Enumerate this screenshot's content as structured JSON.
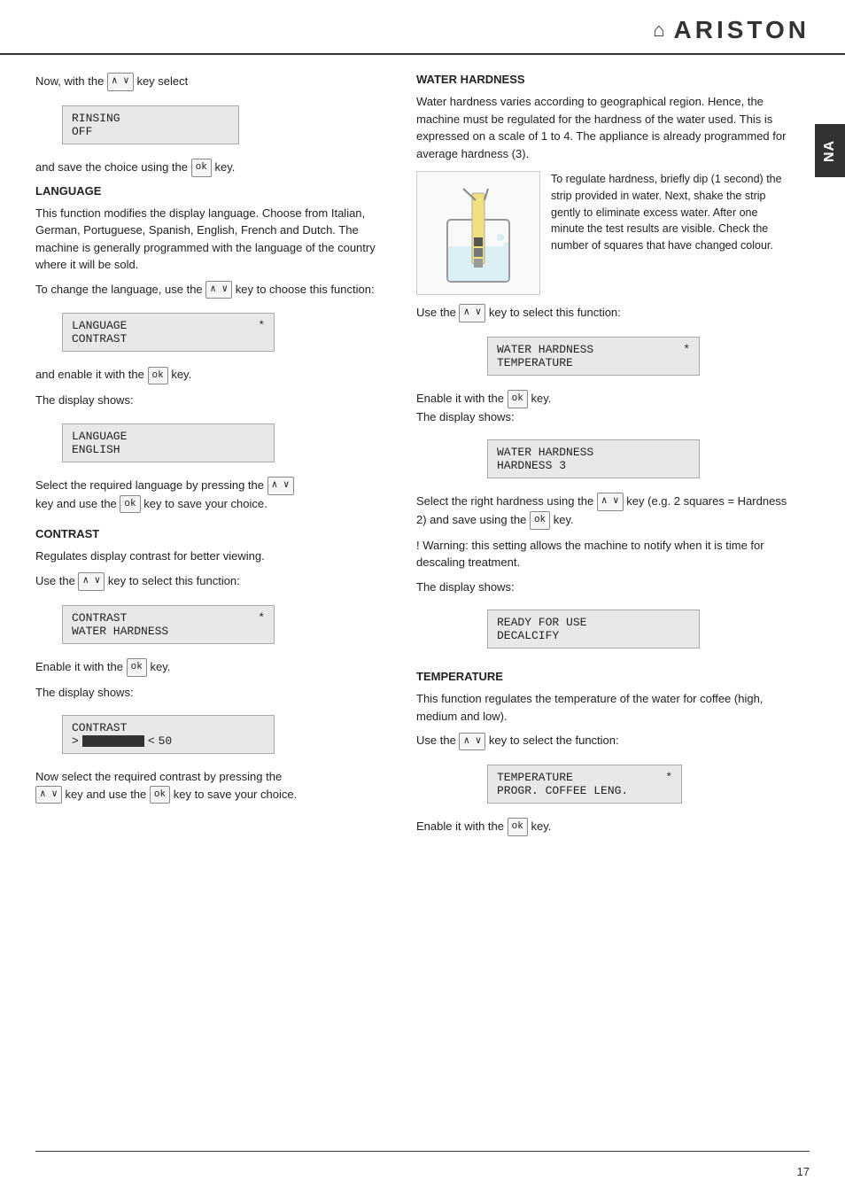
{
  "header": {
    "logo_icon": "🏠",
    "logo_name": "ARISTON"
  },
  "page_tab": "NA",
  "page_number": "17",
  "left_col": {
    "intro_text": "Now, with the",
    "intro_key": "∧  ∨",
    "intro_suffix": "key select",
    "lcd_rinsing": {
      "line1": "RINSING",
      "line2": "OFF"
    },
    "save_text_pre": "and save the choice using the",
    "save_key": "ok",
    "save_text_post": "key.",
    "language_title": "LANGUAGE",
    "language_p1": "This function modifies the display language. Choose from Italian, German, Portuguese, Spanish, English, French and Dutch. The machine is generally programmed with the language of the country where it will be sold.",
    "language_change_pre": "To change the language, use the",
    "language_change_key": "∧  ∨",
    "language_change_post": "key to choose this function:",
    "lcd_lang_select": {
      "line1": "LANGUAGE",
      "line1_star": "*",
      "line2": "CONTRAST"
    },
    "lang_enable_pre": "and enable it with the",
    "lang_enable_key": "ok",
    "lang_enable_post": "key.",
    "display_shows": "The display shows:",
    "lcd_lang_display": {
      "line1": "LANGUAGE",
      "line2": "ENGLISH"
    },
    "lang_select_pre": "Select the required language by pressing the",
    "lang_select_key": "∧  ∨",
    "lang_select_post": "key and use the",
    "lang_save_key": "ok",
    "lang_save_post": "key to save your choice.",
    "contrast_title": "CONTRAST",
    "contrast_p1": "Regulates display contrast for better viewing.",
    "contrast_use_pre": "Use the",
    "contrast_use_key": "∧  ∨",
    "contrast_use_post": "key to select this function:",
    "lcd_contrast_select": {
      "line1": "CONTRAST",
      "line1_star": "*",
      "line2": "WATER HARDNESS"
    },
    "contrast_enable_pre": "Enable it with the",
    "contrast_enable_key": "ok",
    "contrast_enable_post": "key.",
    "contrast_display_shows": "The display shows:",
    "lcd_contrast_display": {
      "line1": "CONTRAST",
      "line2_prefix": ">",
      "line2_bar": "███████",
      "line2_suffix": "<",
      "line2_value": "50"
    },
    "contrast_now_pre": "Now select the required contrast by pressing the",
    "contrast_now_key1": "∧  ∨",
    "contrast_now_mid": "key and use the",
    "contrast_now_key2": "ok",
    "contrast_now_post": "key to save your choice."
  },
  "right_col": {
    "water_hardness_title": "WATER HARDNESS",
    "water_hardness_p1": "Water hardness varies according to geographical region. Hence, the machine must be regulated for the hardness of the water used. This is expressed on a scale of 1 to 4. The appliance is already programmed for average hardness (3).",
    "hardness_image_alt": "water hardness test strip illustration",
    "hardness_desc": "To regulate hardness, briefly dip (1 second) the strip provided in water. Next, shake the strip gently to eliminate excess water. After one minute the test results are visible. Check the number of squares that have changed colour.",
    "hardness_use_pre": "Use the",
    "hardness_use_key": "∧  ∨",
    "hardness_use_post": "key to select this function:",
    "lcd_hardness_select": {
      "line1": "WATER HARDNESS",
      "line1_star": "*",
      "line2": "TEMPERATURE"
    },
    "hardness_enable_pre": "Enable it with the",
    "hardness_enable_key": "ok",
    "hardness_enable_post": "key.",
    "hardness_display_shows": "The display shows:",
    "lcd_hardness_display": {
      "line1": "WATER HARDNESS",
      "line2": "HARDNESS 3"
    },
    "hardness_select_pre": "Select the right hardness using the",
    "hardness_select_key": "∧  ∨",
    "hardness_select_mid": "key (e.g. 2 squares = Hardness 2) and save using the",
    "hardness_select_key2": "ok",
    "hardness_select_post": "key.",
    "hardness_warning": "! Warning: this setting allows the machine to notify when it is time for descaling treatment.",
    "hardness_display_shows2": "The display shows:",
    "lcd_ready": {
      "line1": "READY FOR USE",
      "line2": "DECALCIFY"
    },
    "temperature_title": "TEMPERATURE",
    "temperature_p1": "This function regulates the temperature of the water for coffee (high, medium and low).",
    "temperature_use_pre": "Use the",
    "temperature_use_key": "∧  ∨",
    "temperature_use_post": "key to select the function:",
    "lcd_temp_select": {
      "line1": "TEMPERATURE",
      "line1_star": "*",
      "line2": "PROGR. COFFEE LENG."
    },
    "temperature_enable_pre": "Enable it with the",
    "temperature_enable_key": "ok",
    "temperature_enable_post": "key."
  }
}
